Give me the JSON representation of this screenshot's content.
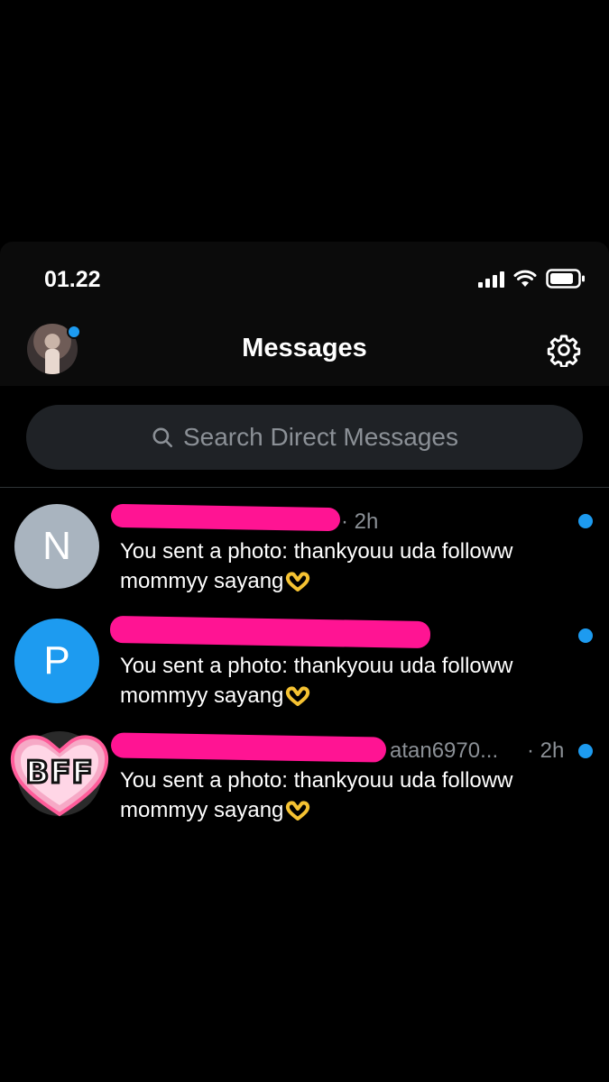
{
  "status_bar": {
    "time": "01.22"
  },
  "header": {
    "title": "Messages"
  },
  "search": {
    "placeholder": "Search Direct Messages"
  },
  "conversations": [
    {
      "avatar_letter": "N",
      "avatar_color": "#a9b4bf",
      "handle_suffix": "",
      "time": "· 2h",
      "preview_line1": "You sent a photo: thankyouu uda followw",
      "preview_line2": "mommyy sayang",
      "unread": true
    },
    {
      "avatar_letter": "P",
      "avatar_color": "#1d9bf0",
      "handle_suffix": "",
      "time": "",
      "preview_line1": "You sent a photo: thankyouu uda followw",
      "preview_line2": "mommyy sayang",
      "unread": true
    },
    {
      "avatar_text": "BFF",
      "handle_suffix": "atan6970...",
      "time": "· 2h",
      "preview_line1": "You sent a photo: thankyouu uda followw",
      "preview_line2": "mommyy sayang",
      "unread": true
    }
  ],
  "colors": {
    "accent": "#1d9bf0",
    "redaction": "#ff1493",
    "background": "#000000"
  }
}
